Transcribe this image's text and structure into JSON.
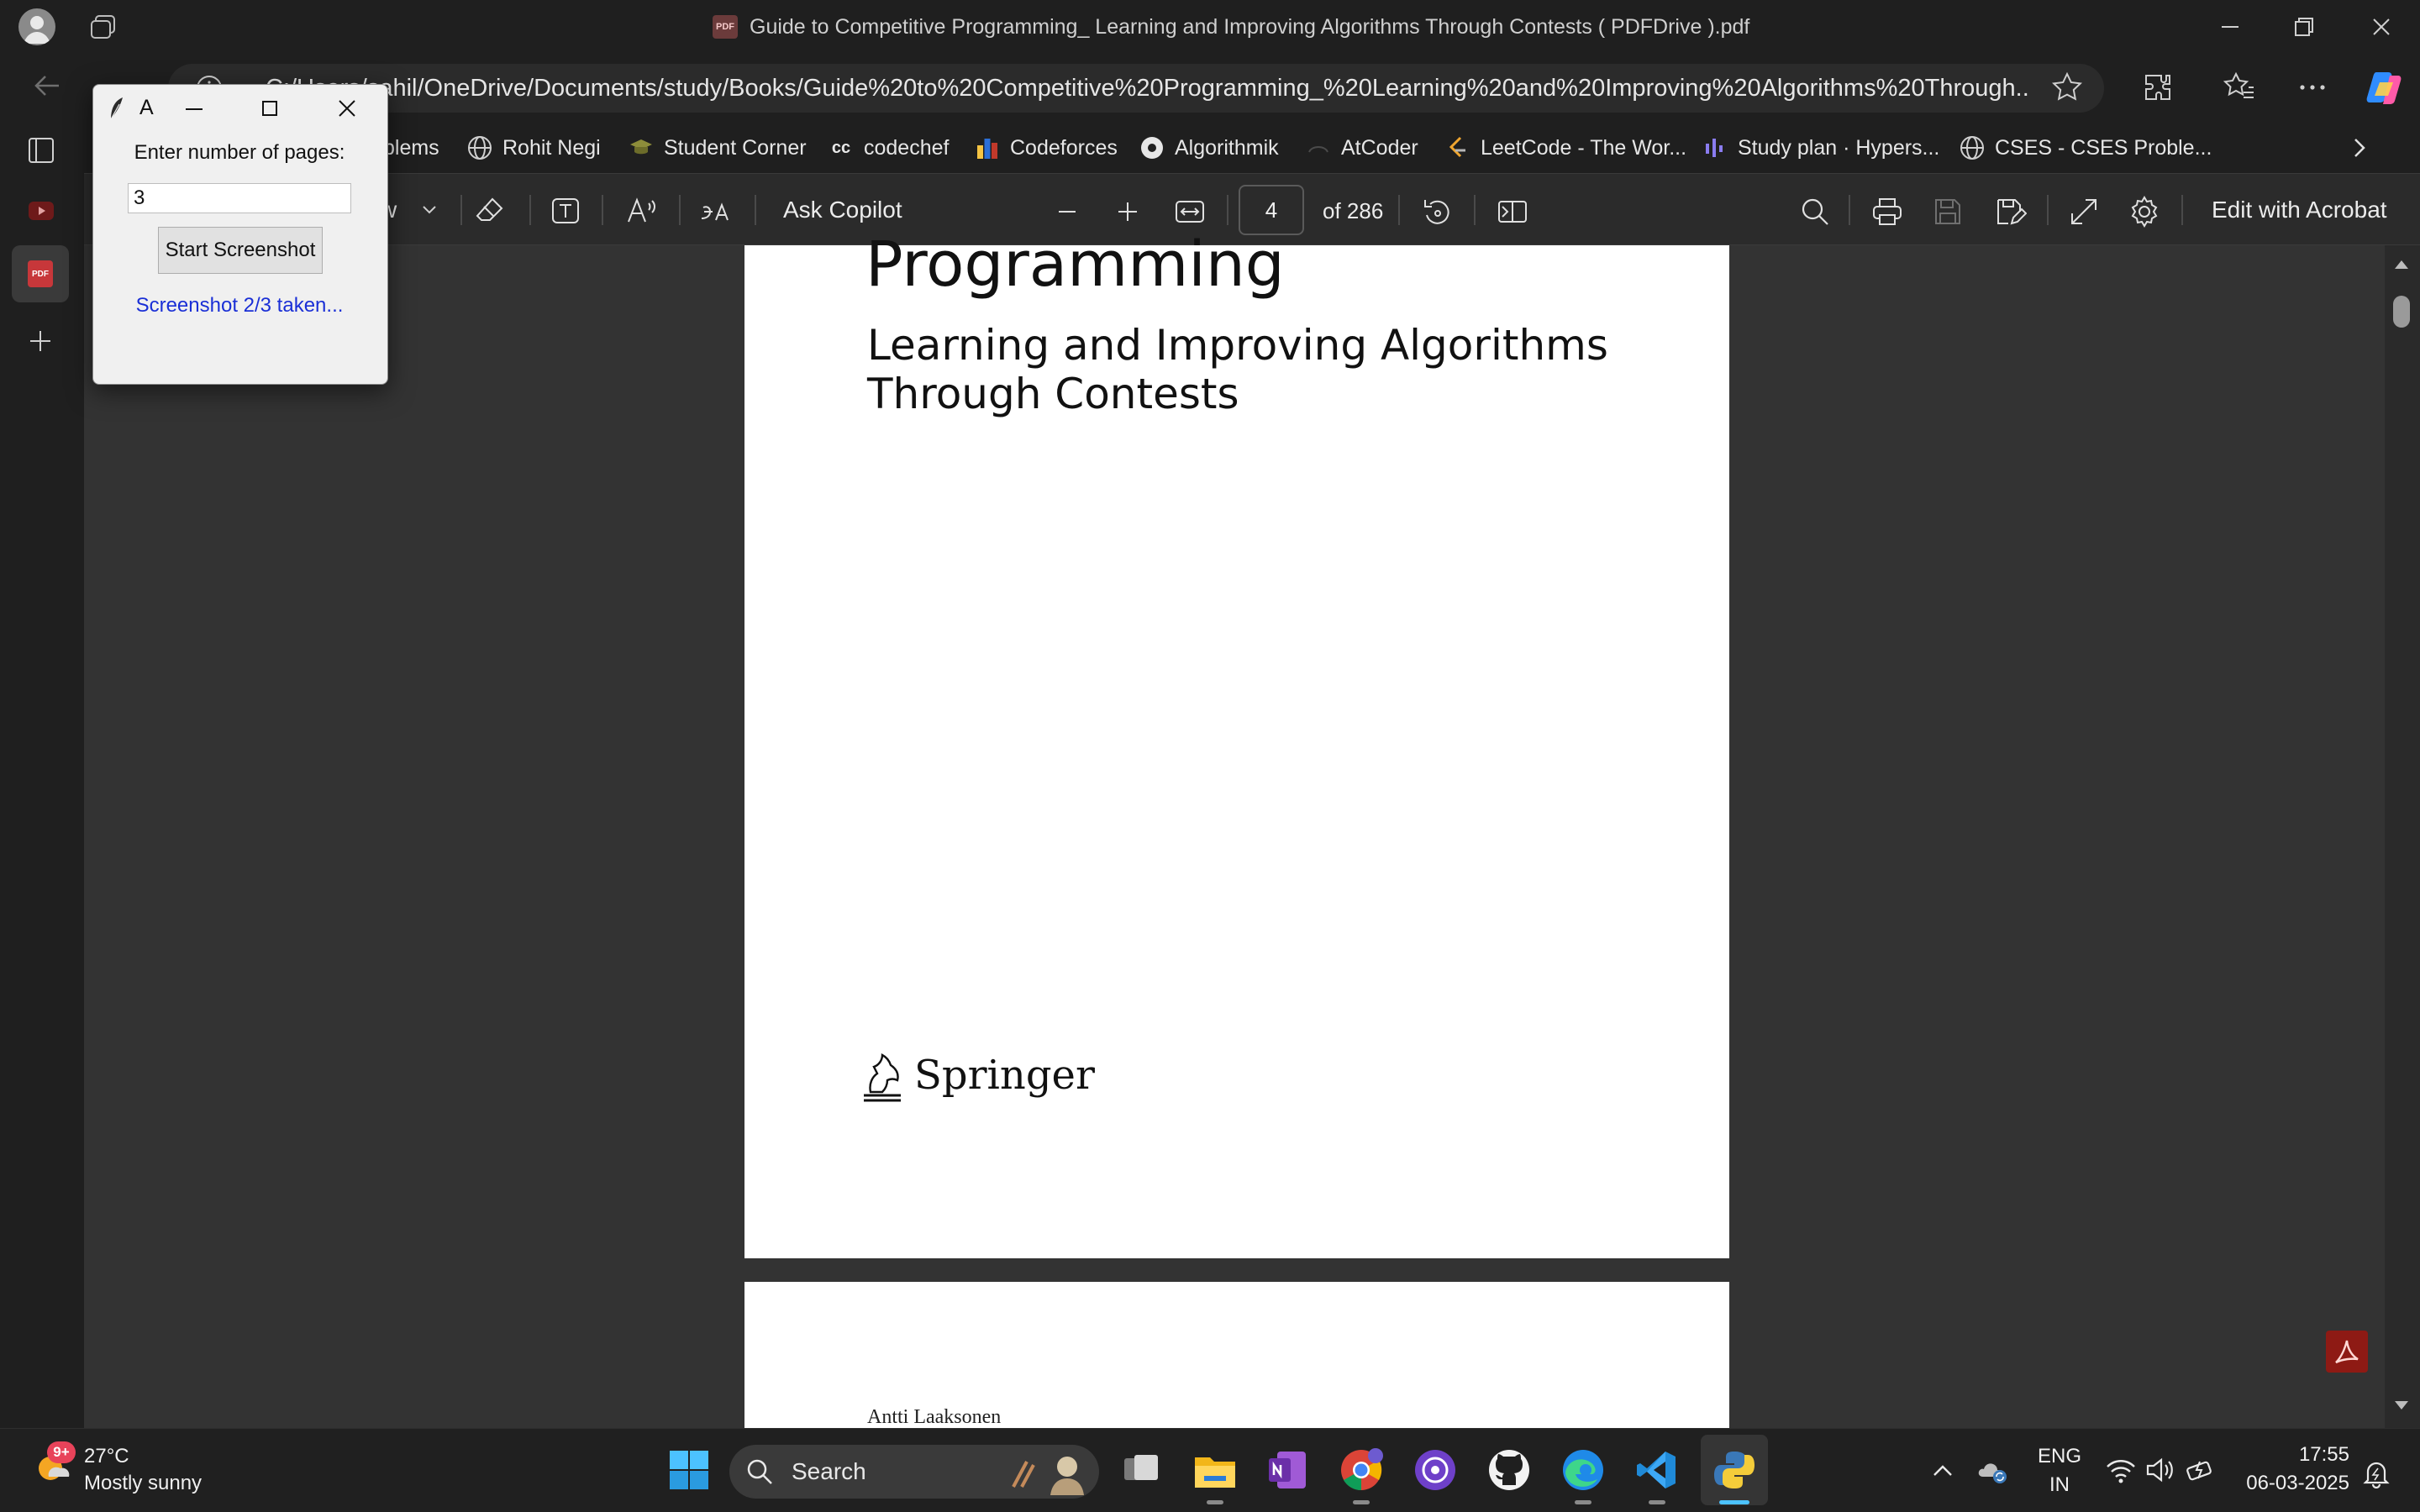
{
  "window": {
    "title": "Guide to Competitive Programming_ Learning and Improving Algorithms Through Contests ( PDFDrive ).pdf"
  },
  "address_bar": {
    "url": "C:/Users/sahil/OneDrive/Documents/study/Books/Guide%20to%20Competitive%20Programming_%20Learning%20and%20Improving%20Algorithms%20Through..."
  },
  "bookmarks": [
    {
      "label": "blems",
      "icon": "folder-icon"
    },
    {
      "label": "Rohit Negi",
      "icon": "globe-icon"
    },
    {
      "label": "Student Corner",
      "icon": "student-corner-icon"
    },
    {
      "label": "codechef",
      "icon": "codechef-icon"
    },
    {
      "label": "Codeforces",
      "icon": "codeforces-icon"
    },
    {
      "label": "Algorithmik",
      "icon": "algorithmik-icon"
    },
    {
      "label": "AtCoder",
      "icon": "atcoder-icon"
    },
    {
      "label": "LeetCode - The Wor...",
      "icon": "leetcode-icon"
    },
    {
      "label": "Study plan · Hypers...",
      "icon": "hyperskill-icon"
    },
    {
      "label": "CSES - CSES Proble...",
      "icon": "globe-icon"
    }
  ],
  "pdf_toolbar": {
    "draw_partial": "w",
    "ask_copilot": "Ask Copilot",
    "current_page": "4",
    "page_total": "of 286",
    "edit_acrobat": "Edit with Acrobat"
  },
  "document": {
    "title_partial": "Programming",
    "subtitle_line1": "Learning and Improving Algorithms",
    "subtitle_line2": "Through Contests",
    "publisher": "Springer",
    "next_page_author": "Antti Laaksonen"
  },
  "tool_window": {
    "title": "A",
    "label": "Enter number of pages:",
    "input_value": "3",
    "button": "Start Screenshot",
    "status": "Screenshot 2/3 taken...",
    "status_color": "#1a2fd6"
  },
  "taskbar": {
    "weather_temp": "27°C",
    "weather_desc": "Mostly sunny",
    "weather_badge": "9+",
    "search_placeholder": "Search",
    "language_line1": "ENG",
    "language_line2": "IN",
    "time": "17:55",
    "date": "06-03-2025"
  },
  "colors": {
    "accent": "#4cc2ff",
    "acrobat_red": "#b30b00"
  }
}
